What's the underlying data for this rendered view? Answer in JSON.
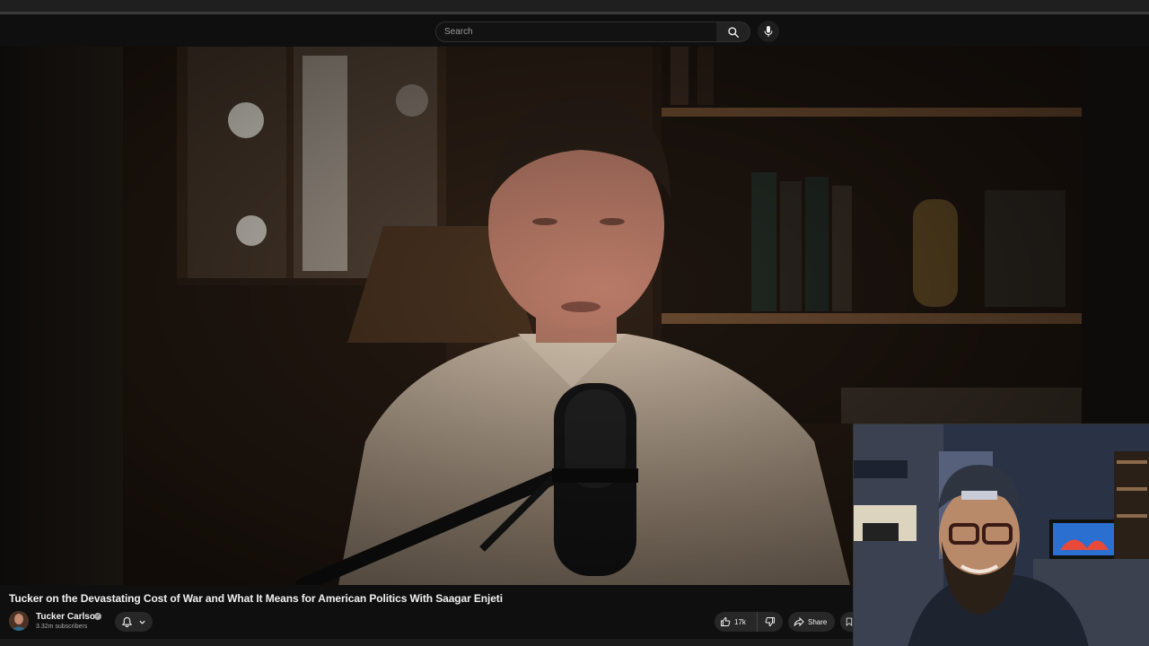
{
  "search": {
    "placeholder": "Search"
  },
  "icons": {
    "search": "search-icon",
    "mic": "microphone-icon",
    "bell": "bell-icon",
    "chevron": "chevron-down-icon",
    "like": "thumbs-up-icon",
    "dislike": "thumbs-down-icon",
    "share": "share-icon",
    "save": "save-icon",
    "verified": "verified-check-icon"
  },
  "video": {
    "title": "Tucker on the Devastating Cost of War and What It Means for American Politics With Saagar Enjeti"
  },
  "channel": {
    "name": "Tucker Carlson",
    "verified_mark": "✓",
    "subscribers": "3.32m subscribers"
  },
  "actions": {
    "like_count": "17k",
    "share_label": "Share"
  },
  "colors": {
    "background": "#0f0f0f",
    "pill": "#272727",
    "text": "#f1f1f1",
    "muted": "#aaaaaa"
  }
}
